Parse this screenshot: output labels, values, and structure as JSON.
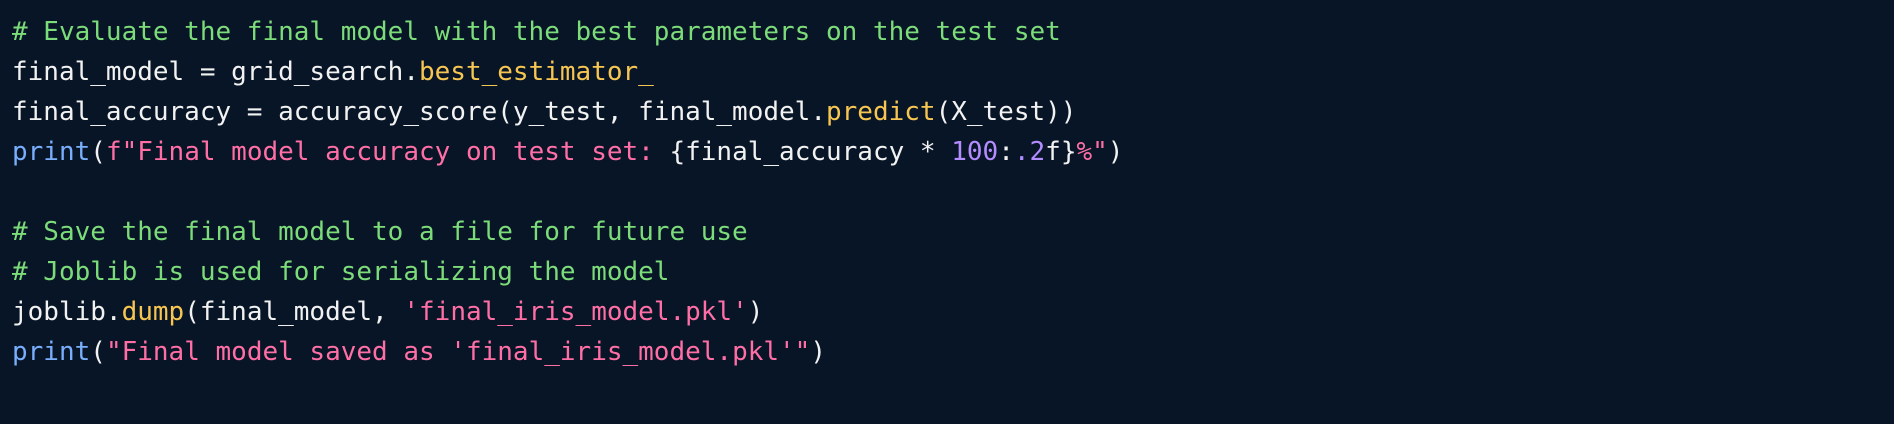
{
  "code": {
    "lines": [
      {
        "tokens": [
          {
            "text": "# Evaluate the final model with the best parameters on the test set",
            "type": "comment"
          }
        ]
      },
      {
        "tokens": [
          {
            "text": "final_model = grid_search.",
            "type": "default"
          },
          {
            "text": "best_estimator_",
            "type": "attr"
          }
        ]
      },
      {
        "tokens": [
          {
            "text": "final_accuracy = accuracy_score(y_test, final_model.",
            "type": "default"
          },
          {
            "text": "predict",
            "type": "attr"
          },
          {
            "text": "(X_test))",
            "type": "default"
          }
        ]
      },
      {
        "tokens": [
          {
            "text": "print",
            "type": "builtin"
          },
          {
            "text": "(",
            "type": "default"
          },
          {
            "text": "f\"Final model accuracy on test set: ",
            "type": "string"
          },
          {
            "text": "{final_accuracy * ",
            "type": "default"
          },
          {
            "text": "100",
            "type": "num"
          },
          {
            "text": ":",
            "type": "default"
          },
          {
            "text": ".2",
            "type": "num"
          },
          {
            "text": "f}",
            "type": "default"
          },
          {
            "text": "%\"",
            "type": "string"
          },
          {
            "text": ")",
            "type": "default"
          }
        ]
      },
      {
        "tokens": []
      },
      {
        "tokens": [
          {
            "text": "# Save the final model to a file for future use",
            "type": "comment"
          }
        ]
      },
      {
        "tokens": [
          {
            "text": "# Joblib is used for serializing the model",
            "type": "comment"
          }
        ]
      },
      {
        "tokens": [
          {
            "text": "joblib.",
            "type": "default"
          },
          {
            "text": "dump",
            "type": "attr"
          },
          {
            "text": "(final_model, ",
            "type": "default"
          },
          {
            "text": "'final_iris_model.pkl'",
            "type": "string"
          },
          {
            "text": ")",
            "type": "default"
          }
        ]
      },
      {
        "tokens": [
          {
            "text": "print",
            "type": "builtin"
          },
          {
            "text": "(",
            "type": "default"
          },
          {
            "text": "\"Final model saved as 'final_iris_model.pkl'\"",
            "type": "string"
          },
          {
            "text": ")",
            "type": "default"
          }
        ]
      }
    ]
  },
  "colors": {
    "background": "#071526",
    "comment": "#7ddc7a",
    "default": "#f2f2f2",
    "builtin": "#79aefc",
    "attr": "#f7c652",
    "string": "#ff6fa6",
    "num": "#b38cff"
  }
}
